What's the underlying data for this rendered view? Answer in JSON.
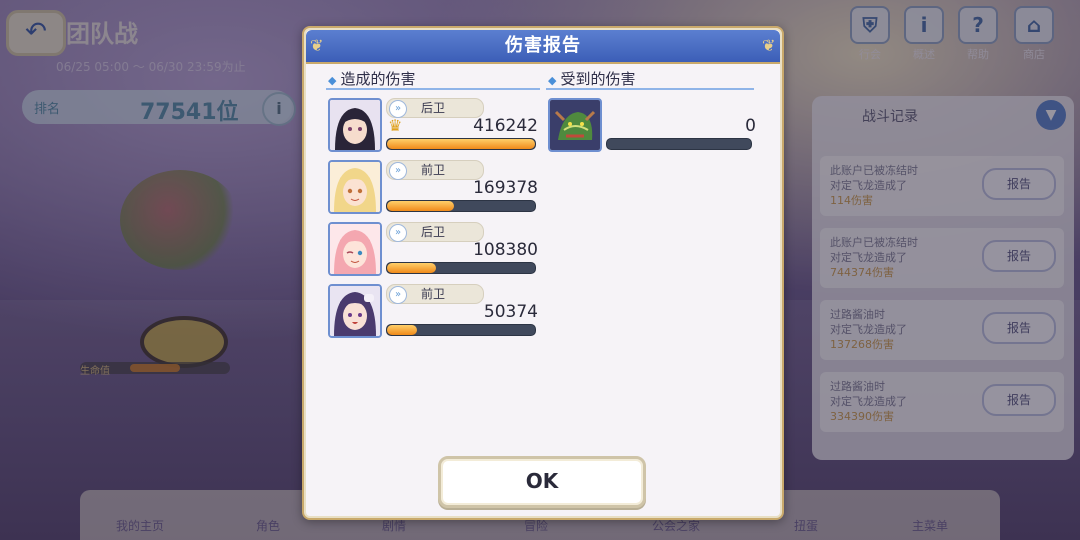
{
  "background": {
    "back_icon": "↶",
    "title": "团队战",
    "period": "06/25 05:00 ～ 06/30 23:59为止",
    "rank_label": "排名",
    "rank_value": "77541位",
    "info_icon": "i",
    "hp_label": "生命值",
    "top_icons": [
      {
        "icon": "shield-icon",
        "glyph": "⛨",
        "label": "行会"
      },
      {
        "icon": "info-icon",
        "glyph": "i",
        "label": "概述"
      },
      {
        "icon": "help-icon",
        "glyph": "?",
        "label": "帮助"
      },
      {
        "icon": "shop-icon",
        "glyph": "⌂",
        "label": "商店"
      }
    ],
    "bottom_nav": [
      "我的主页",
      "角色",
      "剧情",
      "冒险",
      "公会之家",
      "扭蛋",
      "主菜单"
    ],
    "battle_log": {
      "title": "战斗记录",
      "entries": [
        {
          "line1": "此账户已被冻结时",
          "line2": "对定飞龙造成了",
          "damage": "114伤害",
          "button": "报告"
        },
        {
          "line1": "此账户已被冻结时",
          "line2": "对定飞龙造成了",
          "damage": "744374伤害",
          "button": "报告"
        },
        {
          "line1": "过路酱油时",
          "line2": "对定飞龙造成了",
          "damage": "137268伤害",
          "button": "报告"
        },
        {
          "line1": "过路酱油时",
          "line2": "对定飞龙造成了",
          "damage": "334390伤害",
          "button": "报告"
        }
      ]
    }
  },
  "modal": {
    "title": "伤害报告",
    "dealt_title": "造成的伤害",
    "taken_title": "受到的伤害",
    "dealt": [
      {
        "role": "后卫",
        "damage": "416242",
        "fill": 1.0,
        "crown": true
      },
      {
        "role": "前卫",
        "damage": "169378",
        "fill": 0.45,
        "crown": false
      },
      {
        "role": "后卫",
        "damage": "108380",
        "fill": 0.33,
        "crown": false
      },
      {
        "role": "前卫",
        "damage": "50374",
        "fill": 0.2,
        "crown": false
      }
    ],
    "taken": {
      "damage": "0",
      "fill": 0.0
    },
    "ok_label": "OK"
  }
}
